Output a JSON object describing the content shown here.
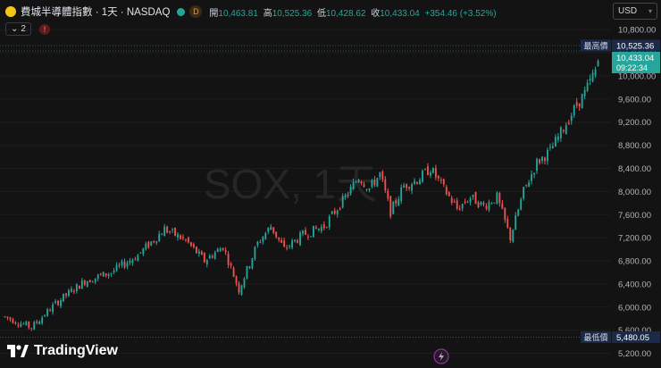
{
  "header": {
    "title": "費城半導體指數 · 1天 · NASDAQ",
    "market_badge": "D",
    "open_label": "開",
    "open": "10,463.81",
    "high_label": "高",
    "high": "10,525.36",
    "low_label": "低",
    "low": "10,428.62",
    "close_label": "收",
    "close": "10,433.04",
    "change": "+354.46 (+3.52%)"
  },
  "indicators": {
    "collapse_count": "2",
    "alert_glyph": "!"
  },
  "currency": {
    "value": "USD"
  },
  "brand": {
    "name": "TradingView"
  },
  "colors": {
    "up": "#26a69a",
    "down": "#ef5350",
    "background": "#131313"
  },
  "chart_data": {
    "type": "candlestick",
    "watermark": "SOX, 1天",
    "y_ticks": [
      5200,
      5600,
      6000,
      6400,
      6800,
      7200,
      7600,
      8000,
      8400,
      8800,
      9200,
      9600,
      10000,
      10400,
      10800
    ],
    "ylim": [
      5100,
      10850
    ],
    "high_marker": {
      "label": "最高價",
      "value": 10525.36,
      "text": "10,525.36"
    },
    "low_marker": {
      "label": "最低價",
      "value": 5480.05,
      "text": "5,480.05"
    },
    "last_price": {
      "text": "10,433.04",
      "value": 10433.04,
      "countdown": "09:22:34"
    },
    "anchors": [
      [
        0,
        5830
      ],
      [
        10,
        5650
      ],
      [
        20,
        6100
      ],
      [
        30,
        6450
      ],
      [
        40,
        6600
      ],
      [
        50,
        6900
      ],
      [
        60,
        7350
      ],
      [
        68,
        7150
      ],
      [
        75,
        6800
      ],
      [
        82,
        7050
      ],
      [
        88,
        6300
      ],
      [
        95,
        7100
      ],
      [
        100,
        7400
      ],
      [
        105,
        7000
      ],
      [
        112,
        7250
      ],
      [
        120,
        7400
      ],
      [
        128,
        7900
      ],
      [
        133,
        8250
      ],
      [
        137,
        8050
      ],
      [
        141,
        8300
      ],
      [
        145,
        7650
      ],
      [
        150,
        8100
      ],
      [
        155,
        8200
      ],
      [
        160,
        8400
      ],
      [
        165,
        8050
      ],
      [
        170,
        7700
      ],
      [
        175,
        7900
      ],
      [
        180,
        7750
      ],
      [
        185,
        7900
      ],
      [
        190,
        7200
      ],
      [
        195,
        8000
      ],
      [
        200,
        8500
      ],
      [
        205,
        8700
      ],
      [
        210,
        9100
      ],
      [
        215,
        9500
      ],
      [
        218,
        9700
      ],
      [
        222,
        10100
      ],
      [
        224,
        10433
      ]
    ],
    "last_candle": {
      "open": 10463.81,
      "high": 10525.36,
      "low": 10428.62,
      "close": 10433.04
    }
  }
}
